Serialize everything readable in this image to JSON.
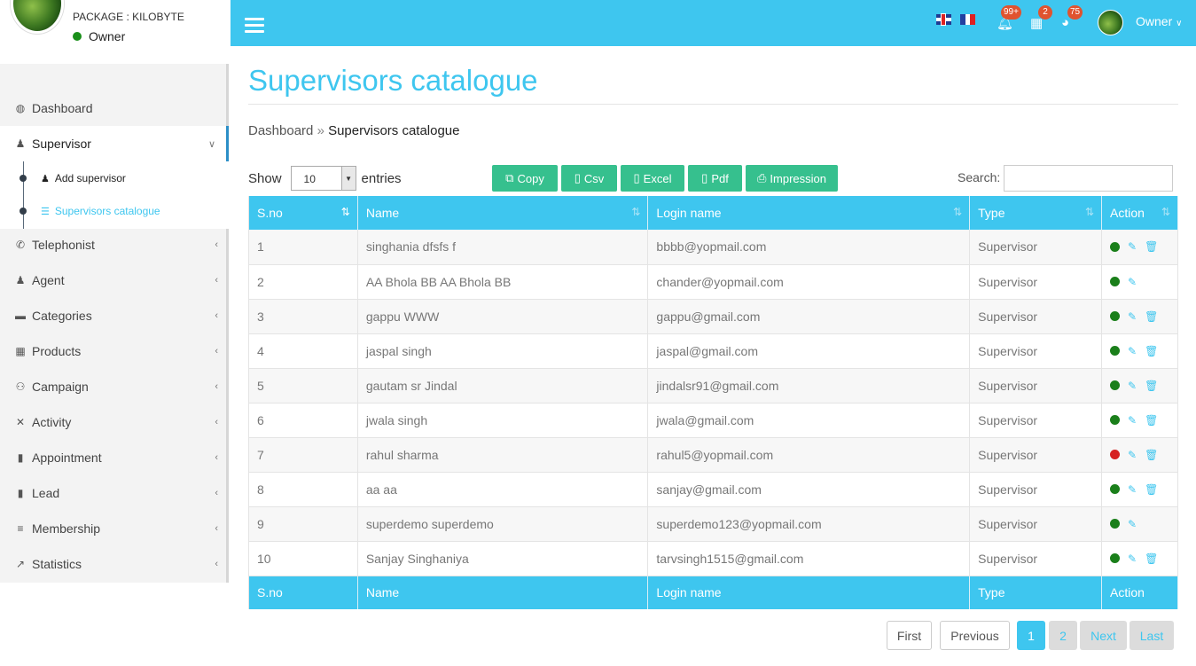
{
  "profile": {
    "package_label": "PACKAGE : KILOBYTE",
    "role": "Owner"
  },
  "sidebar": {
    "items": [
      {
        "label": "Dashboard",
        "icon": "tachometer-icon",
        "glyph": "◍"
      },
      {
        "label": "Supervisor",
        "icon": "user-tie-icon",
        "glyph": "♟"
      },
      {
        "label": "Telephonist",
        "icon": "phone-icon",
        "glyph": "✆"
      },
      {
        "label": "Agent",
        "icon": "user-icon",
        "glyph": "♟"
      },
      {
        "label": "Categories",
        "icon": "folder-icon",
        "glyph": "▬"
      },
      {
        "label": "Products",
        "icon": "briefcase-icon",
        "glyph": "▦"
      },
      {
        "label": "Campaign",
        "icon": "users-icon",
        "glyph": "⚇"
      },
      {
        "label": "Activity",
        "icon": "sitemap-icon",
        "glyph": "✕"
      },
      {
        "label": "Appointment",
        "icon": "book-icon",
        "glyph": "▮"
      },
      {
        "label": "Lead",
        "icon": "book-icon",
        "glyph": "▮"
      },
      {
        "label": "Membership",
        "icon": "bars-icon",
        "glyph": "≡"
      },
      {
        "label": "Statistics",
        "icon": "chart-line-icon",
        "glyph": "↗"
      }
    ],
    "sub_items": [
      {
        "label": "Add supervisor"
      },
      {
        "label": "Supervisors catalogue"
      }
    ]
  },
  "topbar": {
    "notifications_badge": "99+",
    "calendar_badge": "2",
    "globe_badge": "75",
    "user_name": "Owner"
  },
  "page": {
    "title": "Supervisors catalogue",
    "breadcrumb_home": "Dashboard",
    "breadcrumb_sep": "»",
    "breadcrumb_current": "Supervisors catalogue"
  },
  "toolbar": {
    "show_label": "Show",
    "entries_value": "10",
    "entries_label": "entries",
    "buttons": [
      "Copy",
      "Csv",
      "Excel",
      "Pdf",
      "Impression"
    ],
    "search_label": "Search:"
  },
  "table": {
    "columns": [
      "S.no",
      "Name",
      "Login name",
      "Type",
      "Action"
    ],
    "rows": [
      {
        "sno": "1",
        "name": "singhania dfsfs f",
        "login": "bbbb@yopmail.com",
        "type": "Supervisor",
        "status": "active",
        "delete": true
      },
      {
        "sno": "2",
        "name": "AA Bhola BB AA Bhola BB",
        "login": "chander@yopmail.com",
        "type": "Supervisor",
        "status": "active",
        "delete": false
      },
      {
        "sno": "3",
        "name": "gappu WWW",
        "login": "gappu@gmail.com",
        "type": "Supervisor",
        "status": "active",
        "delete": true
      },
      {
        "sno": "4",
        "name": "jaspal singh",
        "login": "jaspal@gmail.com",
        "type": "Supervisor",
        "status": "active",
        "delete": true
      },
      {
        "sno": "5",
        "name": "gautam sr Jindal",
        "login": "jindalsr91@gmail.com",
        "type": "Supervisor",
        "status": "active",
        "delete": true
      },
      {
        "sno": "6",
        "name": "jwala singh",
        "login": "jwala@gmail.com",
        "type": "Supervisor",
        "status": "active",
        "delete": true
      },
      {
        "sno": "7",
        "name": "rahul sharma",
        "login": "rahul5@yopmail.com",
        "type": "Supervisor",
        "status": "inactive",
        "delete": true
      },
      {
        "sno": "8",
        "name": "aa aa",
        "login": "sanjay@gmail.com",
        "type": "Supervisor",
        "status": "active",
        "delete": true
      },
      {
        "sno": "9",
        "name": "superdemo superdemo",
        "login": "superdemo123@yopmail.com",
        "type": "Supervisor",
        "status": "active",
        "delete": false
      },
      {
        "sno": "10",
        "name": "Sanjay Singhaniya",
        "login": "tarvsingh1515@gmail.com",
        "type": "Supervisor",
        "status": "active",
        "delete": true
      }
    ]
  },
  "pagination": {
    "first": "First",
    "previous": "Previous",
    "pages": [
      "1",
      "2"
    ],
    "current_page": "1",
    "next": "Next",
    "last": "Last"
  },
  "colors": {
    "accent": "#3ec6ef",
    "button_green": "#36c08e",
    "status_active": "#1a7f1a",
    "status_inactive": "#d62020"
  }
}
